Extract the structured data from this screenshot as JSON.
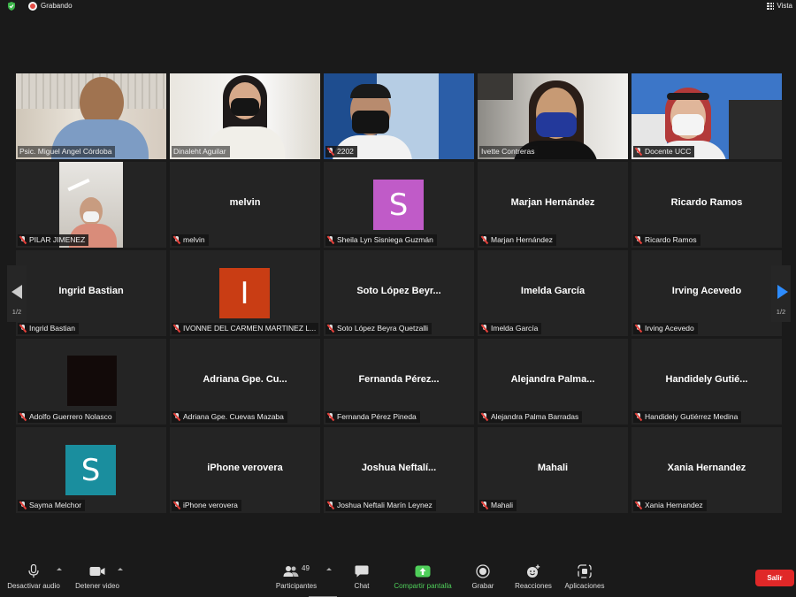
{
  "topbar": {
    "recording_label": "Grabando",
    "view_label": "Vista"
  },
  "participants": [
    {
      "name": "Psic. Miguel Angel Córdoba",
      "display": "video",
      "muted": false,
      "active": false
    },
    {
      "name": "Dinaleht Aguilar",
      "display": "video",
      "muted": false,
      "active": false
    },
    {
      "name": "2202",
      "display": "video",
      "muted": true,
      "active": false
    },
    {
      "name": "Ivette Contreras",
      "display": "video",
      "muted": false,
      "active": true
    },
    {
      "name": "Docente UCC",
      "display": "video",
      "muted": true,
      "active": false
    },
    {
      "name": "PILAR JIMENEZ",
      "display": "video",
      "muted": true,
      "active": false
    },
    {
      "name": "melvin",
      "center": "melvin",
      "display": "name",
      "muted": true
    },
    {
      "name": "Sheila Lyn Sisniega Guzmán",
      "display": "avatar",
      "letter": "S",
      "color": "#c05bc8",
      "muted": true
    },
    {
      "name": "Marjan Hernández",
      "center": "Marjan Hernández",
      "display": "name",
      "muted": true
    },
    {
      "name": "Ricardo Ramos",
      "center": "Ricardo Ramos",
      "display": "name",
      "muted": true
    },
    {
      "name": "Ingrid Bastian",
      "center": "Ingrid Bastian",
      "display": "name",
      "muted": true
    },
    {
      "name": "IVONNE DEL CARMEN MARTINEZ L...",
      "display": "avatar",
      "letter": "I",
      "color": "#c93d14",
      "muted": true
    },
    {
      "name": "Soto López Beyra Quetzalli",
      "center": "Soto López Beyr...",
      "display": "name",
      "muted": true
    },
    {
      "name": "Imelda García",
      "center": "Imelda García",
      "display": "name",
      "muted": true
    },
    {
      "name": "Irving Acevedo",
      "center": "Irving Acevedo",
      "display": "name",
      "muted": true
    },
    {
      "name": "Adolfo Guerrero Nolasco",
      "display": "photo",
      "muted": true
    },
    {
      "name": "Adriana Gpe. Cuevas Mazaba",
      "center": "Adriana Gpe. Cu...",
      "display": "name",
      "muted": true
    },
    {
      "name": "Fernanda Pérez Pineda",
      "center": "Fernanda  Pérez...",
      "display": "name",
      "muted": true
    },
    {
      "name": "Alejandra Palma Barradas",
      "center": "Alejandra  Palma...",
      "display": "name",
      "muted": true
    },
    {
      "name": "Handidely Gutiérrez Medina",
      "center": "Handidely  Gutié...",
      "display": "name",
      "muted": true
    },
    {
      "name": "Sayma Melchor",
      "display": "avatar",
      "letter": "S",
      "color": "#1a8e9e",
      "muted": true
    },
    {
      "name": "iPhone verovera",
      "center": "iPhone verovera",
      "display": "name",
      "muted": true
    },
    {
      "name": "Joshua Neftali Marín Leynez",
      "center": "Joshua  Neftalí...",
      "display": "name",
      "muted": true
    },
    {
      "name": "Mahali",
      "center": "Mahali",
      "display": "name",
      "muted": true
    },
    {
      "name": "Xania Hernandez",
      "center": "Xania Hernandez",
      "display": "name",
      "muted": true
    }
  ],
  "pager": {
    "left_page": "1/2",
    "right_page": "1/2"
  },
  "toolbar": {
    "mute_label": "Desactivar audio",
    "video_label": "Detener video",
    "participants_label": "Participantes",
    "participants_count": "49",
    "chat_label": "Chat",
    "share_label": "Compartir pantalla",
    "record_label": "Grabar",
    "reactions_label": "Reacciones",
    "apps_label": "Aplicaciones",
    "leave_label": "Salir"
  },
  "colors": {
    "share_accent": "#4fcf5a",
    "leave": "#e02828",
    "active_speaker": "#b9e15c",
    "pager_arrow": "#2d8cff"
  }
}
